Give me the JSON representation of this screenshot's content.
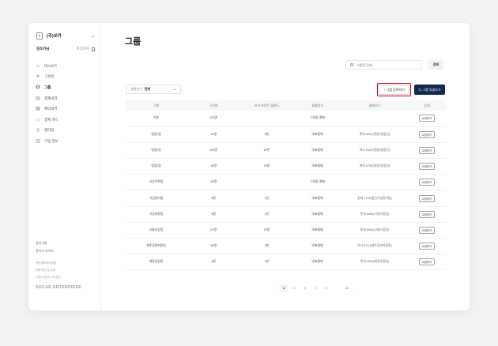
{
  "sidebar": {
    "company": "(주)쏘카",
    "user_name": "김쏘카님",
    "user_role": "조고객사",
    "nav": [
      {
        "label": "대시보드",
        "icon": "home-icon",
        "glyph": "⌂"
      },
      {
        "label": "구성원",
        "icon": "person-icon",
        "glyph": "●"
      },
      {
        "label": "그룹",
        "icon": "group-icon",
        "glyph": "⚇"
      },
      {
        "label": "결제내역",
        "icon": "receipt-icon",
        "glyph": "▤"
      },
      {
        "label": "예약내역",
        "icon": "calendar-icon",
        "glyph": "▦"
      },
      {
        "label": "결제 카드",
        "icon": "card-icon",
        "glyph": "▭"
      },
      {
        "label": "렌터업",
        "icon": "settings-icon",
        "glyph": "◎"
      },
      {
        "label": "기업 정보",
        "icon": "building-icon",
        "glyph": "▥"
      }
    ],
    "active_index": 2,
    "footer_links": [
      "공지사항",
      "관리자 가이드"
    ],
    "footer_small": [
      "개인정보처리방침",
      "이용약관 및 정책",
      "사업자 정보 고객센터"
    ],
    "brand": "SOCAR ENTERPRISE"
  },
  "header": {
    "title": "그룹",
    "search_placeholder": "그룹명 검색",
    "search_button": "검색",
    "filter_label": "결제방식",
    "filter_value": "전체",
    "register_button": "+ 그룹 등록하기",
    "bulk_button": "⇆ 그룹 일괄추가"
  },
  "table": {
    "headers": [
      "그룹",
      "구성원",
      "쏘카 포인트 월한도",
      "결제방식",
      "결제카드",
      "상세"
    ],
    "rows": [
      {
        "group": "기본",
        "members": "223명",
        "limit": "-",
        "payment": "구성원 결제",
        "card": "-"
      },
      {
        "group": "영업1팀",
        "members": "12명",
        "limit": "8만",
        "payment": "대표결제",
        "card": "롯데 6564(영업1팀법인)"
      },
      {
        "group": "영업2팀",
        "members": "102명",
        "limit": "87만",
        "payment": "대표결제",
        "card": "하나 6422(영업2팀법인)"
      },
      {
        "group": "영업3팀",
        "members": "18명",
        "limit": "15만",
        "payment": "대표결제",
        "card": "롯데 6799(영업3팀법인)"
      },
      {
        "group": "사업기획팀",
        "members": "43명",
        "limit": "-",
        "payment": "구성원 결제",
        "card": "-"
      },
      {
        "group": "기업관리팀",
        "members": "4명",
        "limit": "1만",
        "payment": "대표결제",
        "card": "현대 1726(법인기업관리팀)"
      },
      {
        "group": "기업지원팀",
        "members": "3명",
        "limit": "1만",
        "payment": "대표결제",
        "card": "롯데 6464(기업지원팀)"
      },
      {
        "group": "교통사업팀",
        "members": "21명",
        "limit": "13만",
        "payment": "대표결제",
        "card": "롯데 6564(교통사업팀)"
      },
      {
        "group": "제주경영지원팀",
        "members": "10명",
        "limit": "3만",
        "payment": "대표결제",
        "card": "하나 0714(제주경영지원팀)"
      },
      {
        "group": "제휴영업팀",
        "members": "4명",
        "limit": "1만",
        "payment": "대표결제",
        "card": "롯데 6500(제휴영업팀)"
      }
    ],
    "edit_label": "수정하기"
  },
  "pager": {
    "prev": "‹",
    "pages": [
      "1",
      "2",
      "3",
      "4",
      "5",
      "…",
      "00"
    ],
    "current_index": 0,
    "next": "›"
  },
  "colors": {
    "accent_navy": "#0f2a4d",
    "highlight_red": "#d0021b"
  }
}
